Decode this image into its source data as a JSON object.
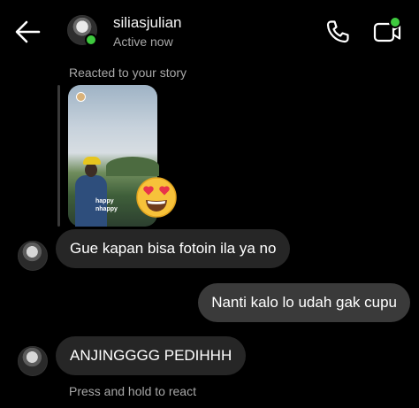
{
  "header": {
    "username": "siliasjulian",
    "status": "Active now",
    "back_icon": "arrow-left-icon",
    "call_icon": "phone-icon",
    "video_icon": "video-camera-icon",
    "online_color": "#3ec93e"
  },
  "story_reply": {
    "label": "Reacted to your story",
    "caption": "happy nhappy",
    "reaction_emoji": "heart-eyes-emoji"
  },
  "messages": [
    {
      "direction": "incoming",
      "text": "Gue kapan bisa fotoin ila ya no"
    },
    {
      "direction": "outgoing",
      "text": "Nanti kalo lo udah gak cupu"
    },
    {
      "direction": "incoming",
      "text": "ANJINGGGG PEDIHHH"
    }
  ],
  "hint": "Press and hold to react",
  "colors": {
    "background": "#000000",
    "incoming_bubble": "#262626",
    "outgoing_bubble": "#3a3a3a",
    "secondary_text": "#a8a8a8"
  }
}
